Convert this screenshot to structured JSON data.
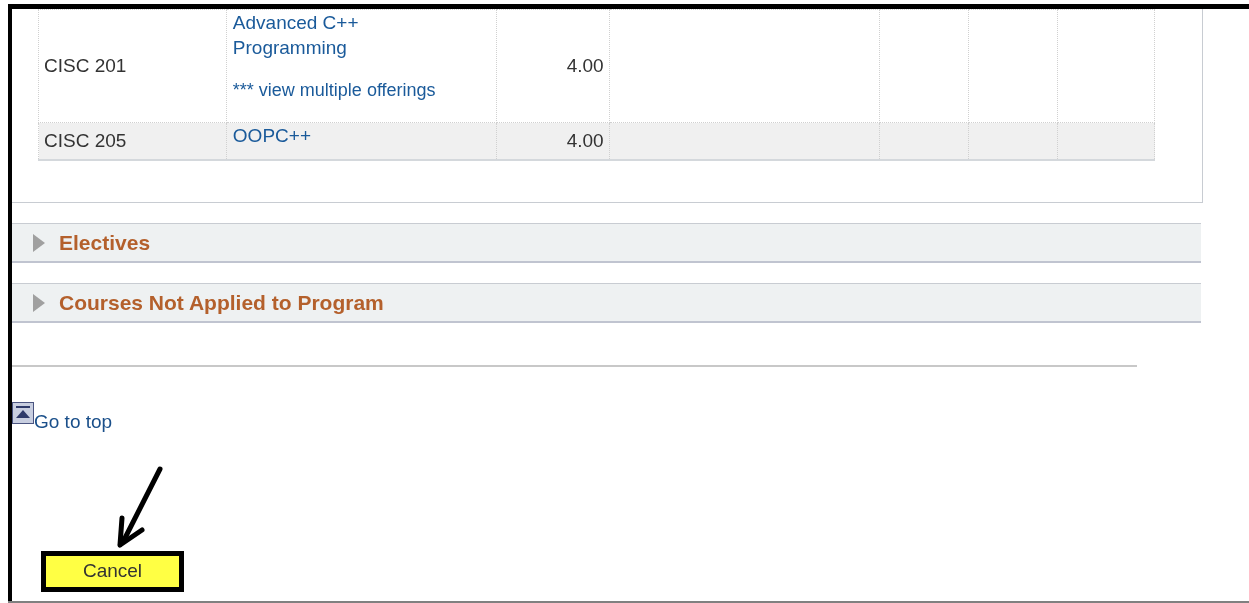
{
  "course_table": {
    "rows": [
      {
        "course": "CISC 201",
        "title": "Advanced C++ Programming",
        "note": "*** view multiple offerings",
        "units": "4.00",
        "shaded": false
      },
      {
        "course": "CISC 205",
        "title": "OOPC++",
        "units": "4.00",
        "shaded": true
      }
    ]
  },
  "sections": [
    {
      "title": "Electives",
      "expanded": false
    },
    {
      "title": "Courses Not Applied to Program",
      "expanded": false
    }
  ],
  "go_to_top": "Go to top",
  "cancel_button": "Cancel"
}
